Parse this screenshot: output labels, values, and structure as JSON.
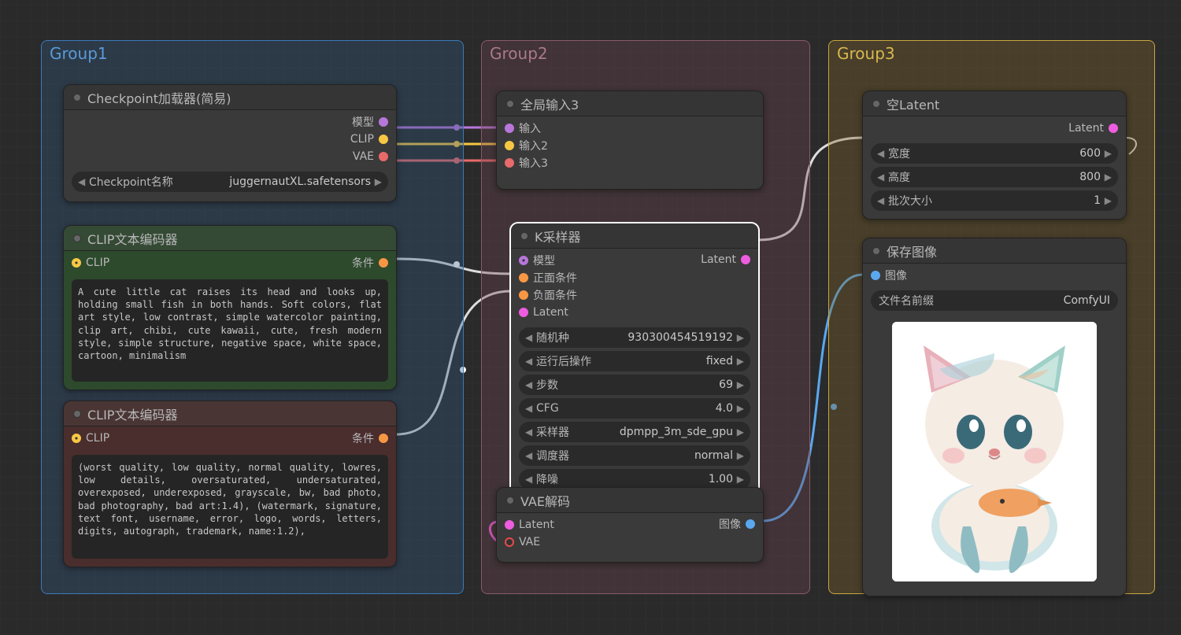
{
  "groups": {
    "g1": "Group1",
    "g2": "Group2",
    "g3": "Group3"
  },
  "checkpoint": {
    "title": "Checkpoint加载器(简易)",
    "outs": [
      "模型",
      "CLIP",
      "VAE"
    ],
    "widget_label": "Checkpoint名称",
    "widget_value": "juggernautXL.safetensors"
  },
  "clip1": {
    "title": "CLIP文本编码器",
    "in": "CLIP",
    "out": "条件",
    "text": "A cute little cat raises its head and looks up, holding small fish in both hands. Soft colors, flat art style, low contrast, simple watercolor painting, clip art, chibi, cute kawaii, cute, fresh modern style, simple structure, negative space, white space, cartoon, minimalism"
  },
  "clip2": {
    "title": "CLIP文本编码器",
    "in": "CLIP",
    "out": "条件",
    "text": "(worst quality, low quality, normal quality, lowres, low details, oversaturated, undersaturated, overexposed, underexposed, grayscale, bw, bad photo, bad photography, bad art:1.4), (watermark, signature, text font, username, error, logo, words, letters, digits, autograph, trademark, name:1.2),"
  },
  "gin": {
    "title": "全局输入3",
    "ins": [
      "输入",
      "输入2",
      "输入3"
    ]
  },
  "ksamp": {
    "title": "K采样器",
    "ins": [
      "模型",
      "正面条件",
      "负面条件",
      "Latent"
    ],
    "out": "Latent",
    "widgets": [
      {
        "label": "随机种",
        "value": "930300454519192"
      },
      {
        "label": "运行后操作",
        "value": "fixed"
      },
      {
        "label": "步数",
        "value": "69"
      },
      {
        "label": "CFG",
        "value": "4.0"
      },
      {
        "label": "采样器",
        "value": "dpmpp_3m_sde_gpu"
      },
      {
        "label": "调度器",
        "value": "normal"
      },
      {
        "label": "降噪",
        "value": "1.00"
      }
    ]
  },
  "vae": {
    "title": "VAE解码",
    "ins": [
      "Latent",
      "VAE"
    ],
    "out": "图像"
  },
  "latemp": {
    "title": "空Latent",
    "out": "Latent",
    "widgets": [
      {
        "label": "宽度",
        "value": "600"
      },
      {
        "label": "高度",
        "value": "800"
      },
      {
        "label": "批次大小",
        "value": "1"
      }
    ]
  },
  "save": {
    "title": "保存图像",
    "in": "图像",
    "widget_label": "文件名前缀",
    "widget_value": "ComfyUI"
  }
}
